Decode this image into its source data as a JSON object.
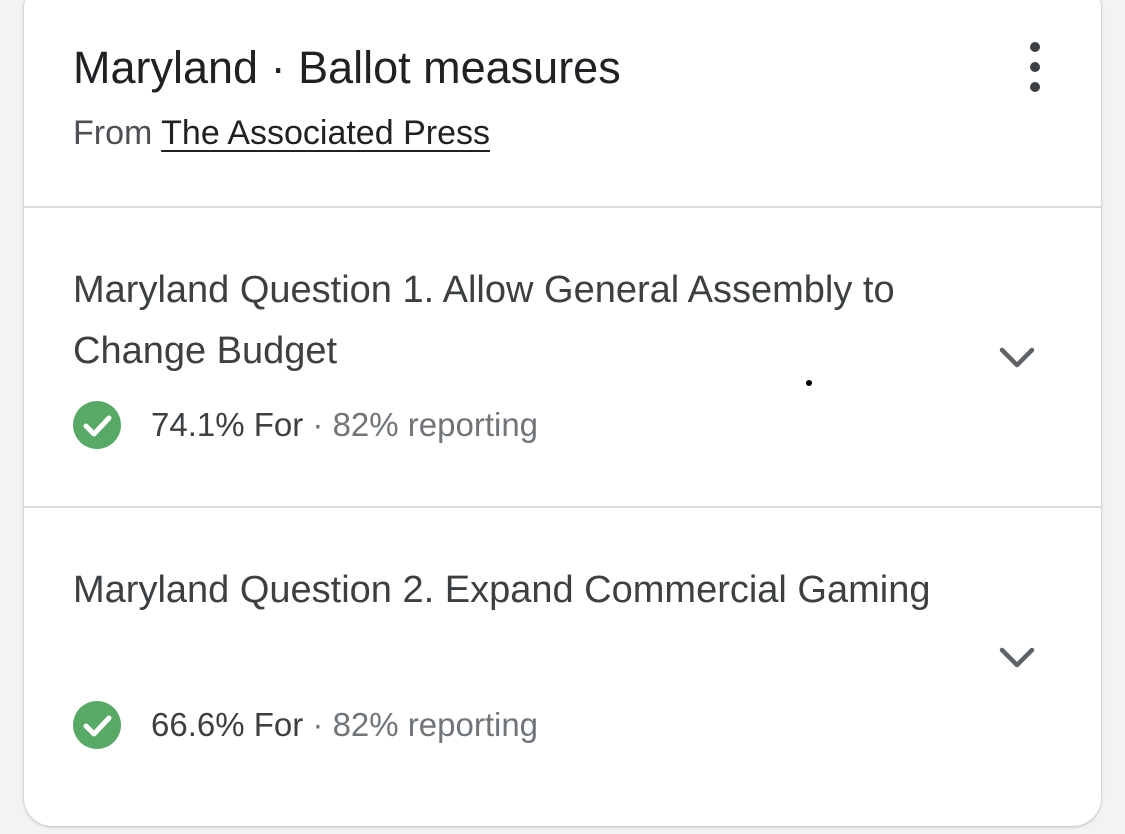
{
  "header": {
    "title": "Maryland · Ballot measures",
    "source_prefix": "From ",
    "source_link": "The Associated Press",
    "menu_icon": "more-vert-icon"
  },
  "measures": [
    {
      "title": "Maryland Question 1. Allow General Assembly to Change Budget",
      "result": "74.1% For",
      "separator": " · ",
      "reporting": "82% reporting",
      "status_icon": "check-circle-icon",
      "expand_icon": "chevron-down-icon"
    },
    {
      "title": "Maryland Question 2. Expand Commercial Gaming",
      "result": "66.6% For",
      "separator": " · ",
      "reporting": "82% reporting",
      "status_icon": "check-circle-icon",
      "expand_icon": "chevron-down-icon"
    }
  ],
  "colors": {
    "check_green": "#58a866",
    "title_text": "#202124",
    "body_text": "#3c4043",
    "muted_text": "#70757a",
    "divider": "#dadce0"
  }
}
